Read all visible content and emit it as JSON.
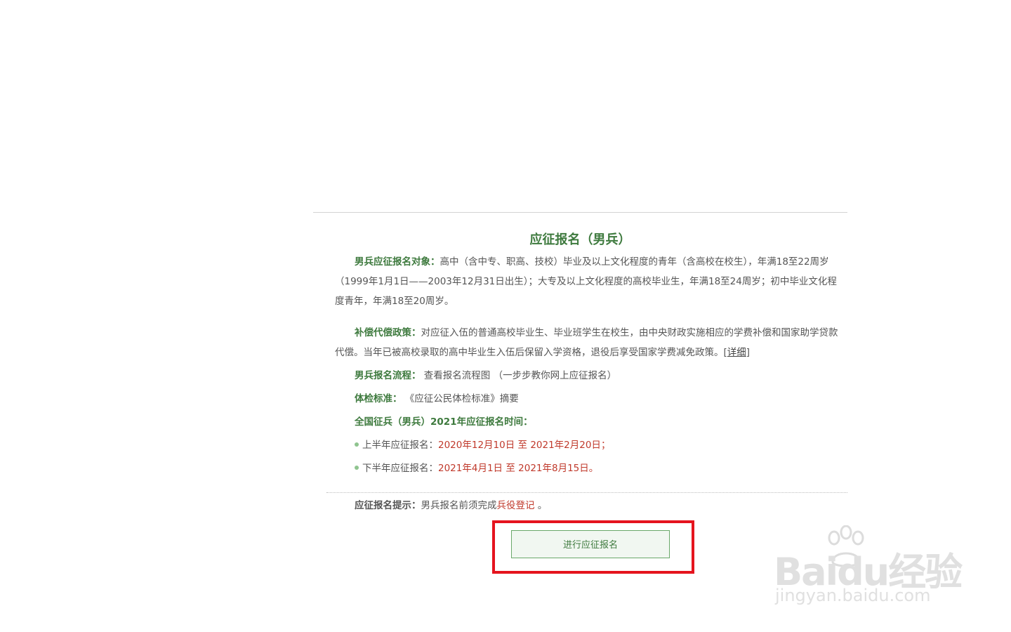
{
  "section": {
    "title": "应征报名（男兵）"
  },
  "eligibility": {
    "label": "男兵应征报名对象：",
    "text": "高中（含中专、职高、技校）毕业及以上文化程度的青年（含高校在校生），年满18至22周岁（1999年1月1日——2003年12月31日出生）；大专及以上文化程度的高校毕业生，年满18至24周岁；初中毕业文化程度青年，年满18至20周岁。"
  },
  "compensation": {
    "label": "补偿代偿政策：",
    "text": "对应征入伍的普通高校毕业生、毕业班学生在校生，由中央财政实施相应的学费补偿和国家助学贷款代偿。当年已被高校录取的高中毕业生入伍后保留入学资格，退役后享受国家学费减免政策。",
    "detail_open": "[",
    "detail_link": "详细",
    "detail_close": "]"
  },
  "process": {
    "label": "男兵报名流程：",
    "link1": "查看报名流程图",
    "paren_open": "（",
    "link2": "一步步教你网上应征报名",
    "paren_close": "）"
  },
  "physical": {
    "label": "体检标准：",
    "link": "《应征公民体检标准》摘要"
  },
  "schedule": {
    "heading": "全国征兵（男兵）2021年应征报名时间：",
    "items": [
      {
        "label": "上半年应征报名：",
        "start": "2020年12月10日",
        "sep": "至",
        "end": "2021年2月20日",
        "tail": "；"
      },
      {
        "label": "下半年应征报名：",
        "start": "2021年4月1日",
        "sep": "至",
        "end": "2021年8月15日",
        "tail": "。"
      }
    ]
  },
  "tip": {
    "label": "应征报名提示：",
    "text": "男兵报名前须完成",
    "link": "兵役登记",
    "tail": "。"
  },
  "action": {
    "button_label": "进行应征报名"
  },
  "watermark": {
    "brand": "Bai",
    "brand_mid": "du",
    "brand_cn": "经验",
    "url": "jingyan.baidu.com"
  },
  "colors": {
    "accent_green": "#3e7a3e",
    "date_red": "#c0392b",
    "highlight_frame": "#e5141e"
  }
}
